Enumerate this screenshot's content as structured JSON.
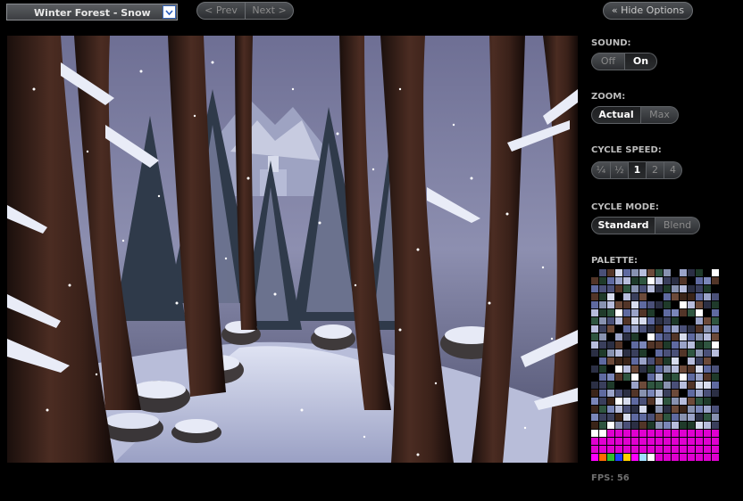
{
  "toolbar": {
    "scene_selected": "Winter Forest - Snow",
    "prev_label": "< Prev",
    "next_label": "Next >",
    "hide_options_label": "« Hide Options"
  },
  "options": {
    "sound": {
      "label": "SOUND:",
      "options": [
        "Off",
        "On"
      ],
      "selected": "On"
    },
    "zoom": {
      "label": "ZOOM:",
      "options": [
        "Actual",
        "Max"
      ],
      "selected": "Actual"
    },
    "cycle_speed": {
      "label": "CYCLE SPEED:",
      "options": [
        "¼",
        "½",
        "1",
        "2",
        "4"
      ],
      "selected": "1"
    },
    "cycle_mode": {
      "label": "CYCLE MODE:",
      "options": [
        "Standard",
        "Blend"
      ],
      "selected": "Standard"
    },
    "palette_label": "PALETTE:"
  },
  "palette_colors": {
    "base": [
      "#5f6aa0",
      "#7a86b8",
      "#9aa3c8",
      "#b7bddc",
      "#4a5078",
      "#3a3f5c",
      "#2b2f44",
      "#6c4a3a",
      "#523528",
      "#3a2418",
      "#1f3a2a",
      "#2f5540",
      "#d7dcee",
      "#ffffff",
      "#000000",
      "#8892b0"
    ],
    "magenta": "#e000d0",
    "accents": [
      "#ff00ff",
      "#ff6a00",
      "#2fbf2f",
      "#2040ff",
      "#ffd000",
      "#ff00ff",
      "#a0e0ff",
      "#ffffff"
    ]
  },
  "status": {
    "fps": "FPS: 56"
  }
}
